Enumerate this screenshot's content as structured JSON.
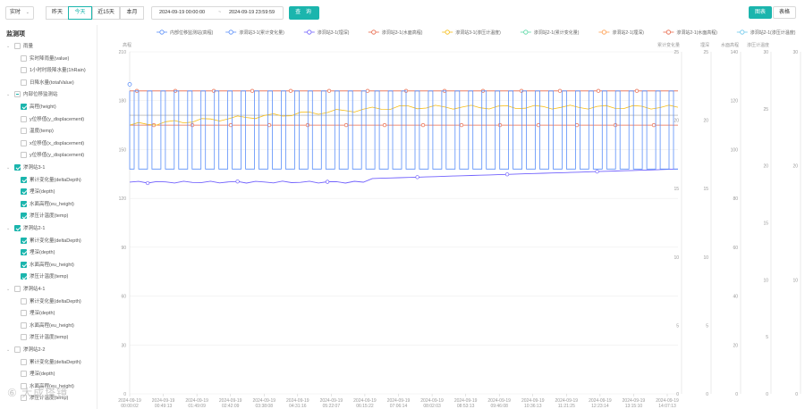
{
  "toolbar": {
    "mode_select": "实时",
    "range_buttons": [
      "昨天",
      "今天",
      "近15天",
      "本月"
    ],
    "active_range": 1,
    "date_start": "2024-09-19 00:00:00",
    "date_sep": "~",
    "date_end": "2024-09-19 23:59:59",
    "query_label": "查 询",
    "view_chart": "图表",
    "view_table": "表格",
    "accent": "#1bb5ad"
  },
  "sidebar": {
    "title": "监测项",
    "tree": [
      {
        "level": 0,
        "label": "雨量",
        "state": "off",
        "arrow": true
      },
      {
        "level": 1,
        "label": "实时降雨量(value)",
        "state": "off"
      },
      {
        "level": 1,
        "label": "1小时时段降水量(1hRain)",
        "state": "off"
      },
      {
        "level": 1,
        "label": "日降水量(totalValue)",
        "state": "off"
      },
      {
        "level": 0,
        "label": "内部位移监测站",
        "state": "half",
        "arrow": true
      },
      {
        "level": 1,
        "label": "高程(height)",
        "state": "on"
      },
      {
        "level": 1,
        "label": "y位移值(y_displacement)",
        "state": "off"
      },
      {
        "level": 1,
        "label": "温度(temp)",
        "state": "off"
      },
      {
        "level": 1,
        "label": "x位移值(x_displacement)",
        "state": "off"
      },
      {
        "level": 1,
        "label": "y位移值(y_displacement)",
        "state": "off"
      },
      {
        "level": 0,
        "label": "渗洞站3-1",
        "state": "on",
        "arrow": true
      },
      {
        "level": 1,
        "label": "累计变化量(deltaDepth)",
        "state": "on"
      },
      {
        "level": 1,
        "label": "埋深(depth)",
        "state": "on"
      },
      {
        "level": 1,
        "label": "水面高程(eu_height)",
        "state": "on"
      },
      {
        "level": 1,
        "label": "渗压计温度(temp)",
        "state": "on"
      },
      {
        "level": 0,
        "label": "渗洞站2-1",
        "state": "on",
        "arrow": true
      },
      {
        "level": 1,
        "label": "累计变化量(deltaDepth)",
        "state": "on"
      },
      {
        "level": 1,
        "label": "埋深(depth)",
        "state": "on"
      },
      {
        "level": 1,
        "label": "水面高程(eu_height)",
        "state": "on"
      },
      {
        "level": 1,
        "label": "渗压计温度(temp)",
        "state": "on"
      },
      {
        "level": 0,
        "label": "渗洞站4-1",
        "state": "off",
        "arrow": true
      },
      {
        "level": 1,
        "label": "累计变化量(deltaDepth)",
        "state": "off"
      },
      {
        "level": 1,
        "label": "埋深(depth)",
        "state": "off"
      },
      {
        "level": 1,
        "label": "水面高程(eu_height)",
        "state": "off"
      },
      {
        "level": 1,
        "label": "渗压计温度(temp)",
        "state": "off"
      },
      {
        "level": 0,
        "label": "渗洞站2-2",
        "state": "off",
        "arrow": true
      },
      {
        "level": 1,
        "label": "累计变化量(deltaDepth)",
        "state": "off"
      },
      {
        "level": 1,
        "label": "埋深(depth)",
        "state": "off"
      },
      {
        "level": 1,
        "label": "水面高程(eu_height)",
        "state": "off"
      },
      {
        "level": 1,
        "label": "渗压计温度(temp)",
        "state": "off"
      }
    ]
  },
  "watermark": "⑥ 大成塔镜",
  "chart_data": {
    "type": "line",
    "legend": [
      {
        "name": "内部位移监测站(高程)",
        "color": "#5b8ff9"
      },
      {
        "name": "渗洞站3-1(累计变化量)",
        "color": "#5b8ff9"
      },
      {
        "name": "渗洞站3-1(埋深)",
        "color": "#7262fd"
      },
      {
        "name": "渗洞站3-1(水面高程)",
        "color": "#e8684a"
      },
      {
        "name": "渗洞站3-1(渗压计温度)",
        "color": "#f6bd16"
      },
      {
        "name": "渗洞站2-1(累计变化量)",
        "color": "#5ad8a6"
      },
      {
        "name": "渗洞站2-1(埋深)",
        "color": "#ff9d4d"
      },
      {
        "name": "渗洞站2-1(水面高程)",
        "color": "#e8684a"
      },
      {
        "name": "渗洞站2-1(渗压计温度)",
        "color": "#6dc8ec"
      }
    ],
    "axes": [
      {
        "id": "left",
        "label": "高程",
        "min": 0,
        "max": 210,
        "ticks": [
          0,
          30,
          60,
          90,
          120,
          150,
          180,
          210
        ]
      },
      {
        "id": "r1",
        "label": "累计变化量",
        "min": 0,
        "max": 25,
        "ticks": [
          0,
          5,
          10,
          15,
          20,
          25
        ]
      },
      {
        "id": "r2",
        "label": "埋深",
        "min": 0,
        "max": 25,
        "ticks": [
          0,
          5,
          10,
          15,
          20,
          25
        ]
      },
      {
        "id": "r3",
        "label": "水面高程",
        "min": 0,
        "max": 140,
        "ticks": [
          0,
          20,
          40,
          60,
          80,
          100,
          120,
          140
        ]
      },
      {
        "id": "r4",
        "label": "渗压计温度",
        "min": 0,
        "max": 30,
        "ticks": [
          0,
          5,
          10,
          15,
          20,
          25,
          30
        ]
      },
      {
        "id": "r5",
        "label": "",
        "min": 0,
        "max": 30,
        "ticks": [
          0,
          10,
          20,
          30
        ]
      }
    ],
    "x_labels": [
      [
        "2024-09-19",
        "00:00:02"
      ],
      [
        "2024-09-19",
        "00:49:13"
      ],
      [
        "2024-09-19",
        "01:49:09"
      ],
      [
        "2024-09-19",
        "02:42:09"
      ],
      [
        "2024-09-19",
        "03:38:08"
      ],
      [
        "2024-09-19",
        "04:31:16"
      ],
      [
        "2024-09-19",
        "05:22:07"
      ],
      [
        "2024-09-19",
        "06:15:22"
      ],
      [
        "2024-09-19",
        "07:06:14"
      ],
      [
        "2024-09-19",
        "08:02:03"
      ],
      [
        "2024-09-19",
        "08:53:13"
      ],
      [
        "2024-09-19",
        "09:46:08"
      ],
      [
        "2024-09-19",
        "10:36:13"
      ],
      [
        "2024-09-19",
        "11:21:25"
      ],
      [
        "2024-09-19",
        "12:23:14"
      ],
      [
        "2024-09-19",
        "13:15:10"
      ],
      [
        "2024-09-19",
        "14:07:13"
      ]
    ],
    "series": [
      {
        "name": "渗洞站3-1(水面高程)",
        "axis": "left",
        "color": "#e8684a",
        "constant": 186
      },
      {
        "name": "渗洞站2-1(水面高程)",
        "axis": "left",
        "color": "#e8684a",
        "constant": 165
      },
      {
        "name": "内部位移监测站(高程)",
        "axis": "left",
        "color": "#5b8ff9",
        "high": 186,
        "low": 138
      },
      {
        "name": "渗洞站3-1(渗压计温度)",
        "axis": "left",
        "color": "#f6bd16",
        "start": 165,
        "end": 176
      },
      {
        "name": "渗洞站3-1(埋深)",
        "axis": "left",
        "color": "#7262fd",
        "start": 130,
        "end": 138
      },
      {
        "name": "渗洞站2-1(累计变化量)",
        "axis": "left",
        "color": "#a0a0a0",
        "constant": 171
      }
    ],
    "grid": true
  }
}
